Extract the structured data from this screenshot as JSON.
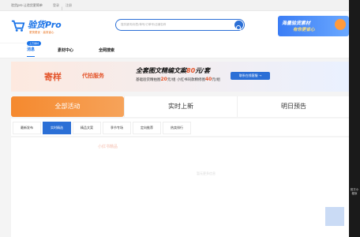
{
  "topbar": {
    "slogan": "验货pro 让验货更简单",
    "login": "登录",
    "divider": "|",
    "register": "注册"
  },
  "header": {
    "logo_name": "验货Pro",
    "logo_sub": "更快更优 · 高效省心",
    "search_placeholder": "搜关键词/标签/单号/订单号/店铺名称",
    "promo_line1": "海量验货素材",
    "promo_line2": "有你更省心"
  },
  "nav": {
    "pill": "上万素材",
    "items": [
      "消息",
      "素材中心",
      "全网搜索"
    ]
  },
  "ad": {
    "brand": "寄样",
    "brand2": "代拍服务",
    "headline_prefix": "全套图文精编文案",
    "headline_price": "80",
    "headline_unit": "元/套",
    "line1_prefix": "基础验货精拍图",
    "line1_price": "20",
    "line1_unit": "元/组",
    "line1_suffix": " 小红书同款精修图",
    "line1_price2": "40",
    "line1_unit2": "元/组",
    "cta": "联系在线客服 →"
  },
  "tabs": [
    "全部活动",
    "实时上新",
    "明日预告"
  ],
  "subtabs": [
    "最新发布",
    "实时精选",
    "精品文案",
    "季节专场",
    "定向推荐",
    "热卖排行"
  ],
  "content": {
    "brand_tag": "小红书精品",
    "hint": "暂无更多信息"
  },
  "sidebar": {
    "label": "官方小程序"
  },
  "colors": {
    "primary": "#1a73e8",
    "accent": "#f5892e",
    "price": "#e4572e"
  }
}
